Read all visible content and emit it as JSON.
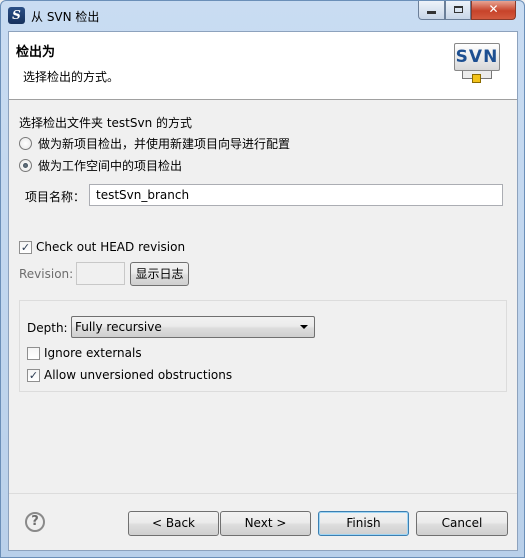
{
  "window": {
    "title": "从 SVN 检出",
    "app_icon": "S",
    "minimize_icon": "minimize-icon",
    "maximize_icon": "maximize-icon",
    "close_label": "✕"
  },
  "header": {
    "title": "检出为",
    "description": "选择检出的方式。",
    "logo_text": "SVN"
  },
  "checkout_mode": {
    "label": "选择检出文件夹 testSvn 的方式",
    "options": [
      {
        "label": "做为新项目检出，并使用新建项目向导进行配置",
        "selected": false
      },
      {
        "label": "做为工作空间中的项目检出",
        "selected": true
      }
    ]
  },
  "project": {
    "label": "项目名称：",
    "value": "testSvn_branch"
  },
  "revision": {
    "head_label": "Check out HEAD revision",
    "head_checked": true,
    "revision_label": "Revision:",
    "revision_value": "",
    "show_log_label": "显示日志"
  },
  "options": {
    "depth_label": "Depth:",
    "depth_value": "Fully recursive",
    "ignore_externals_label": "Ignore externals",
    "ignore_externals_checked": false,
    "allow_unversioned_label": "Allow unversioned obstructions",
    "allow_unversioned_checked": true
  },
  "footer": {
    "help_icon": "?",
    "back_label": "< Back",
    "next_label": "Next >",
    "finish_label": "Finish",
    "cancel_label": "Cancel"
  },
  "colors": {
    "accent": "#3c7fb1",
    "titlebar": "#c9dcf2",
    "close_button": "#c7432a"
  }
}
